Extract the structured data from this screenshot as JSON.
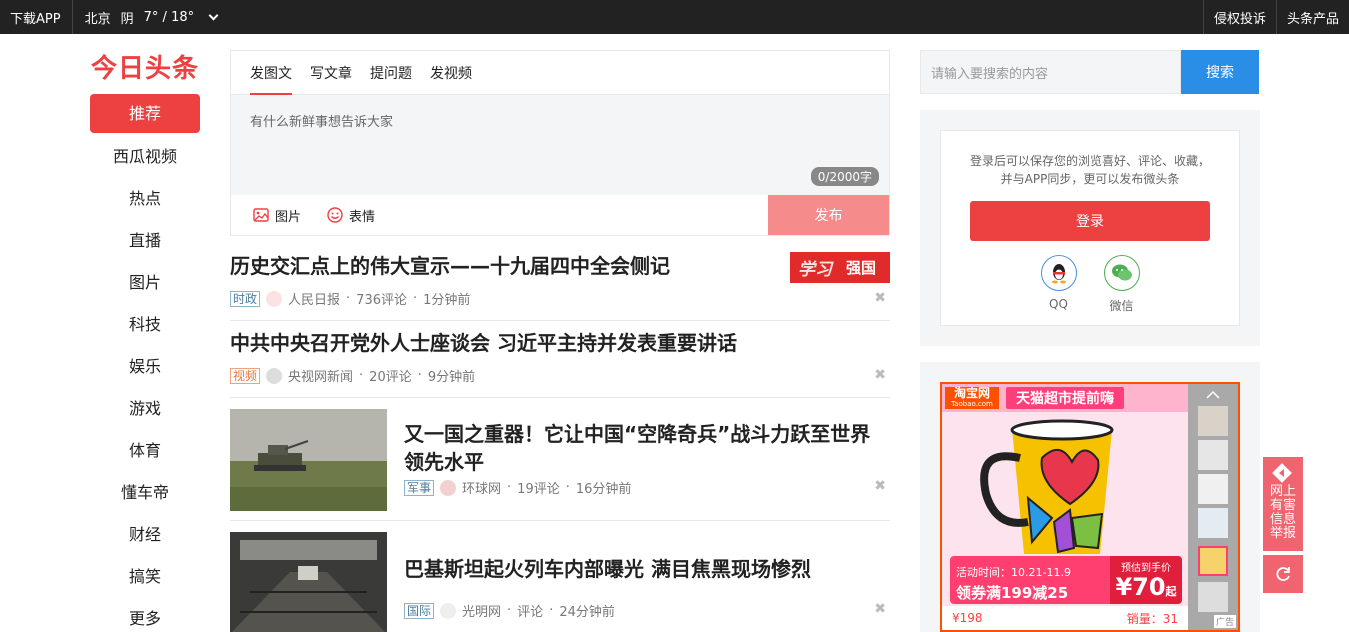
{
  "topbar": {
    "download_app": "下载APP",
    "city": "北京",
    "weather": "阴",
    "temp_low": "7°",
    "temp_sep": "/",
    "temp_high": "18°",
    "complaint": "侵权投诉",
    "products": "头条产品"
  },
  "logo": "今日头条",
  "nav": [
    {
      "label": "推荐",
      "active": true
    },
    {
      "label": "西瓜视频"
    },
    {
      "label": "热点"
    },
    {
      "label": "直播"
    },
    {
      "label": "图片"
    },
    {
      "label": "科技"
    },
    {
      "label": "娱乐"
    },
    {
      "label": "游戏"
    },
    {
      "label": "体育"
    },
    {
      "label": "懂车帝"
    },
    {
      "label": "财经"
    },
    {
      "label": "搞笑"
    },
    {
      "label": "更多"
    }
  ],
  "publisher": {
    "tabs": [
      "发图文",
      "写文章",
      "提问题",
      "发视频"
    ],
    "placeholder": "有什么新鲜事想告诉大家",
    "counter": "0/2000字",
    "image_label": "图片",
    "emoji_label": "表情",
    "submit": "发布"
  },
  "feed": [
    {
      "title": "历史交汇点上的伟大宣示——十九届四中全会侧记",
      "tag": "时政",
      "source": "人民日报",
      "comments": "736评论",
      "time": "1分钟前",
      "banner": "强国",
      "banner_script": "学习"
    },
    {
      "title": "中共中央召开党外人士座谈会 习近平主持并发表重要讲话",
      "tag": "视频",
      "source": "央视网新闻",
      "comments": "20评论",
      "time": "9分钟前"
    },
    {
      "title": "又一国之重器！它让中国“空降奇兵”战斗力跃至世界领先水平",
      "tag": "军事",
      "source": "环球网",
      "comments": "19评论",
      "time": "16分钟前"
    },
    {
      "title": "巴基斯坦起火列车内部曝光 满目焦黑现场惨烈",
      "tag": "国际",
      "source": "光明网",
      "comments": "评论",
      "time": "24分钟前"
    }
  ],
  "search": {
    "placeholder": "请输入要搜索的内容",
    "button": "搜索"
  },
  "login": {
    "tip_line1": "登录后可以保存您的浏览喜好、评论、收藏，",
    "tip_line2": "并与APP同步，更可以发布微头条",
    "button": "登录",
    "qq": "QQ",
    "wechat": "微信"
  },
  "ad": {
    "brand": "淘宝网",
    "brand_sub": "Taobao.com",
    "headline": "天猫超市提前嗨",
    "time": "活动时间：10.21-11.9",
    "coupon": "领券满199减25",
    "presale_label": "预估到手价",
    "presale_price": "¥70",
    "presale_suffix": "起",
    "price": "¥198",
    "sales": "销量：31",
    "mark": "广告"
  },
  "float": {
    "report": "网上有害信息举报"
  },
  "colors": {
    "brand_red": "#ed4040",
    "search_blue": "#2b8ee6",
    "topbar": "#222222"
  }
}
